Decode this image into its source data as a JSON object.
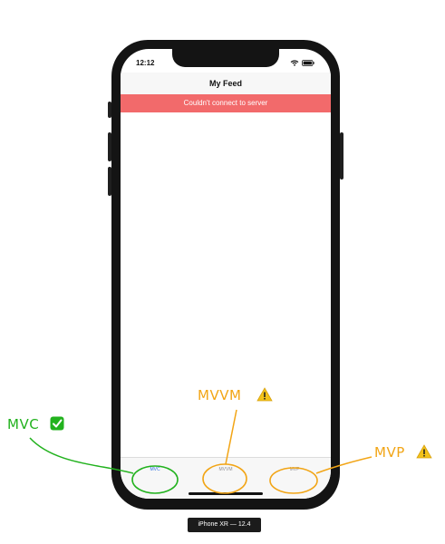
{
  "status_bar": {
    "time": "12:12"
  },
  "nav": {
    "title": "My Feed"
  },
  "error_banner": {
    "text": "Couldn't connect to server"
  },
  "tabs": [
    {
      "label": "MVC",
      "active": true
    },
    {
      "label": "MVVM",
      "active": false
    },
    {
      "label": "MVP",
      "active": false
    }
  ],
  "simulator_caption": "iPhone XR — 12.4",
  "annotations": {
    "mvc": {
      "label": "MVC",
      "icon": "check-mark-icon",
      "color": "#22b21e"
    },
    "mvvm": {
      "label": "MVVM",
      "icon": "warning-icon",
      "color": "#f2a516"
    },
    "mvp": {
      "label": "MVP",
      "icon": "warning-icon",
      "color": "#f2a516"
    }
  },
  "colors": {
    "error_banner": "#f26a6b",
    "active_tab": "#2f6fe0",
    "inactive_tab": "#8e8e93",
    "annotation_green": "#22b21e",
    "annotation_orange": "#f2a516"
  }
}
